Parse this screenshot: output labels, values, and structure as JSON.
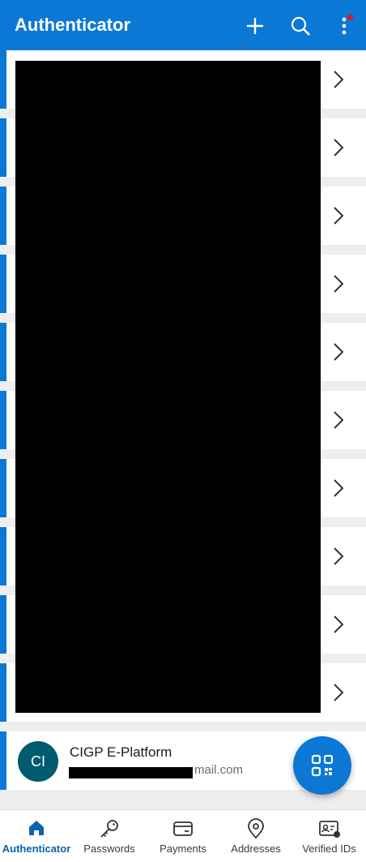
{
  "appbar": {
    "title": "Authenticator",
    "actions": [
      "add-icon",
      "search-icon",
      "more-vertical-icon"
    ],
    "has_notification_dot": true
  },
  "account_rows_redacted": 10,
  "visible_account": {
    "avatar_initials": "CI",
    "name": "CIGP E-Platform",
    "email_visible_suffix": "mail.com"
  },
  "fab": {
    "icon": "qr-code-icon"
  },
  "bottom_nav": {
    "items": [
      {
        "label": "Authenticator",
        "icon": "home-icon",
        "active": true
      },
      {
        "label": "Passwords",
        "icon": "key-icon",
        "active": false
      },
      {
        "label": "Payments",
        "icon": "credit-card-icon",
        "active": false
      },
      {
        "label": "Addresses",
        "icon": "location-pin-icon",
        "active": false
      },
      {
        "label": "Verified IDs",
        "icon": "id-card-icon",
        "active": false
      }
    ]
  },
  "colors": {
    "accent": "#0a78d4",
    "avatar": "#005b70",
    "notification": "#e81123"
  }
}
